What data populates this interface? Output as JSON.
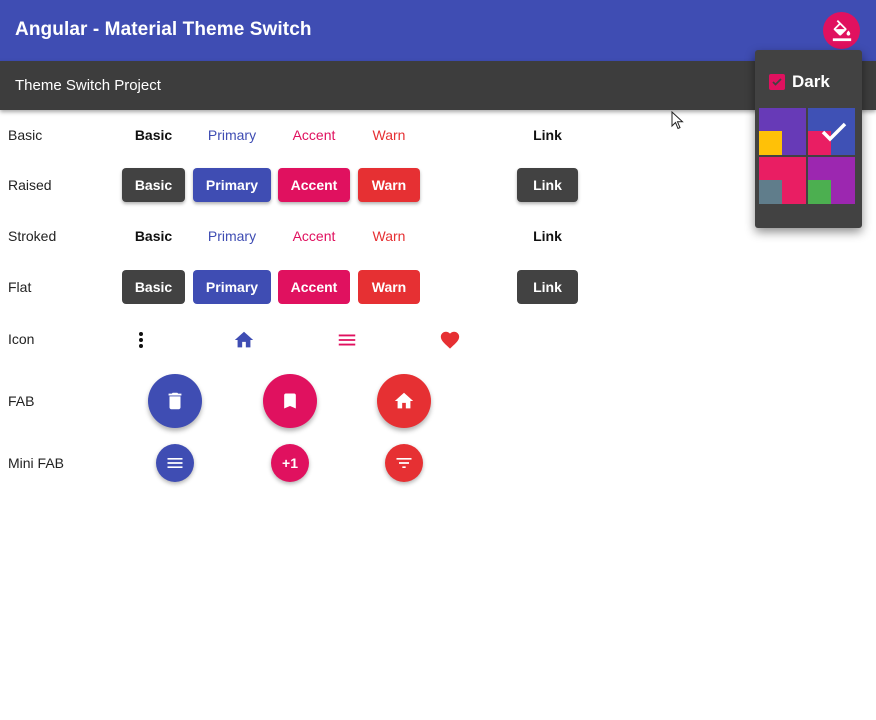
{
  "app": {
    "title": "Angular - Material Theme Switch"
  },
  "subheader": {
    "title": "Theme Switch Project"
  },
  "rows": {
    "basic": "Basic",
    "raised": "Raised",
    "stroked": "Stroked",
    "flat": "Flat",
    "icon": "Icon",
    "fab": "FAB",
    "mini_fab": "Mini FAB"
  },
  "buttons": {
    "basic": "Basic",
    "primary": "Primary",
    "accent": "Accent",
    "warn": "Warn",
    "link": "Link"
  },
  "icons": {
    "row": [
      "more-vert-icon",
      "home-icon",
      "menu-icon",
      "favorite-icon"
    ],
    "fab": [
      "delete-icon",
      "bookmark-icon",
      "home-icon"
    ],
    "mini_fab": [
      "menu-icon",
      "plus-one-icon",
      "filter-list-icon"
    ]
  },
  "mini_fab_plus_one": "+1",
  "theme_menu": {
    "dark_label": "Dark",
    "dark_checked": true,
    "themes": [
      {
        "name": "deeppurple-amber",
        "primary": "#673ab7",
        "accent": "#ffc107",
        "selected": false
      },
      {
        "name": "indigo-pink",
        "primary": "#3f51b5",
        "accent": "#e91e63",
        "selected": true
      },
      {
        "name": "pink-bluegrey",
        "primary": "#e91e63",
        "accent": "#607d8b",
        "selected": false
      },
      {
        "name": "purple-green",
        "primary": "#9c27b0",
        "accent": "#4caf50",
        "selected": false
      }
    ]
  },
  "colors": {
    "primary": "#3f4db3",
    "accent": "#e0115f",
    "warn": "#e63033",
    "toolbar_dark": "#3d3d3d",
    "basic_button": "#424242"
  }
}
